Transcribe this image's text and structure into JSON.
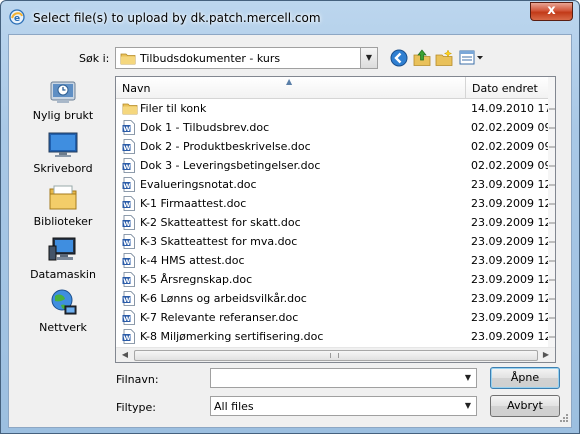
{
  "window": {
    "title": "Select file(s) to upload by dk.patch.mercell.com",
    "close_glyph": "x"
  },
  "lookin": {
    "label": "Søk i:",
    "value": "Tilbudsdokumenter - kurs"
  },
  "toolbar": {
    "icons": [
      "back-icon",
      "up-folder-icon",
      "new-folder-icon",
      "view-menu-icon"
    ]
  },
  "places": [
    {
      "label": "Nylig brukt",
      "icon": "recent-places-icon"
    },
    {
      "label": "Skrivebord",
      "icon": "desktop-icon"
    },
    {
      "label": "Biblioteker",
      "icon": "libraries-icon"
    },
    {
      "label": "Datamaskin",
      "icon": "computer-icon"
    },
    {
      "label": "Nettverk",
      "icon": "network-icon"
    }
  ],
  "columns": {
    "name": "Navn",
    "date": "Dato endret"
  },
  "files": [
    {
      "name": "Filer til konk",
      "date": "14.09.2010 17:1",
      "type": "folder"
    },
    {
      "name": "Dok 1 - Tilbudsbrev.doc",
      "date": "02.02.2009 09:3",
      "type": "doc"
    },
    {
      "name": "Dok 2 - Produktbeskrivelse.doc",
      "date": "02.02.2009 09:4",
      "type": "doc"
    },
    {
      "name": "Dok 3 - Leveringsbetingelser.doc",
      "date": "02.02.2009 09:4",
      "type": "doc"
    },
    {
      "name": "Evalueringsnotat.doc",
      "date": "23.09.2009 12:4",
      "type": "doc"
    },
    {
      "name": "K-1 Firmaattest.doc",
      "date": "23.09.2009 12:1",
      "type": "doc"
    },
    {
      "name": "K-2 Skatteattest for skatt.doc",
      "date": "23.09.2009 12:4",
      "type": "doc"
    },
    {
      "name": "K-3 Skatteattest for mva.doc",
      "date": "23.09.2009 12:4",
      "type": "doc"
    },
    {
      "name": "k-4 HMS attest.doc",
      "date": "23.09.2009 12:4",
      "type": "doc"
    },
    {
      "name": "K-5 Årsregnskap.doc",
      "date": "23.09.2009 12:4",
      "type": "doc"
    },
    {
      "name": "K-6 Lønns og arbeidsvilkår.doc",
      "date": "23.09.2009 12:4",
      "type": "doc"
    },
    {
      "name": "K-7 Relevante referanser.doc",
      "date": "23.09.2009 12:4",
      "type": "doc"
    },
    {
      "name": "K-8 Miljømerking sertifisering.doc",
      "date": "23.09.2009 12:4",
      "type": "doc"
    }
  ],
  "filename": {
    "label": "Filnavn:",
    "value": ""
  },
  "filetype": {
    "label": "Filtype:",
    "value": "All files"
  },
  "buttons": {
    "open": "Åpne",
    "cancel": "Avbryt"
  }
}
